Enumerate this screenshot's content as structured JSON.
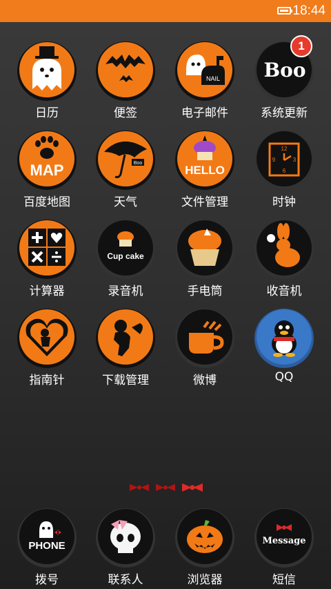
{
  "status_bar": {
    "time": "18:44",
    "icons": [
      "battery-icon"
    ]
  },
  "apps": [
    {
      "label": "日历",
      "icon": "ghost-icon"
    },
    {
      "label": "便签",
      "icon": "bats-icon"
    },
    {
      "label": "电子邮件",
      "icon": "mailbox-ghost-icon",
      "icon_text": "NAIL"
    },
    {
      "label": "系统更新",
      "icon": "boo-icon",
      "icon_text": "Boo",
      "badge": "1"
    },
    {
      "label": "百度地图",
      "icon": "paw-map-icon",
      "icon_text": "MAP"
    },
    {
      "label": "天气",
      "icon": "umbrella-icon",
      "icon_text": "Boo"
    },
    {
      "label": "文件管理",
      "icon": "hello-cupcake-icon",
      "icon_text": "HELLO"
    },
    {
      "label": "时钟",
      "icon": "clock-icon",
      "icon_text": [
        "12",
        "3",
        "6",
        "9"
      ]
    },
    {
      "label": "计算器",
      "icon": "calculator-icon"
    },
    {
      "label": "录音机",
      "icon": "cupcake-icon",
      "icon_text": "Cup cake"
    },
    {
      "label": "手电筒",
      "icon": "cupcake-flashlight-icon"
    },
    {
      "label": "收音机",
      "icon": "rabbit-icon"
    },
    {
      "label": "指南针",
      "icon": "cupid-heart-icon"
    },
    {
      "label": "下载管理",
      "icon": "cupid-icon"
    },
    {
      "label": "微博",
      "icon": "cup-icon"
    },
    {
      "label": "QQ",
      "icon": "penguin-icon"
    }
  ],
  "dock": [
    {
      "label": "拨号",
      "icon": "phone-ghost-icon",
      "icon_text": "PHONE"
    },
    {
      "label": "联系人",
      "icon": "skull-bow-icon"
    },
    {
      "label": "浏览器",
      "icon": "pumpkin-icon"
    },
    {
      "label": "短信",
      "icon": "message-icon",
      "icon_text": "Message"
    }
  ],
  "page_indicator": {
    "count": 3,
    "current": 2
  },
  "colors": {
    "accent": "#f07c1c",
    "icon_orange": "#f27a16",
    "icon_black": "#111111",
    "badge": "#e53b2c",
    "qq_blue": "#3a78c8"
  }
}
